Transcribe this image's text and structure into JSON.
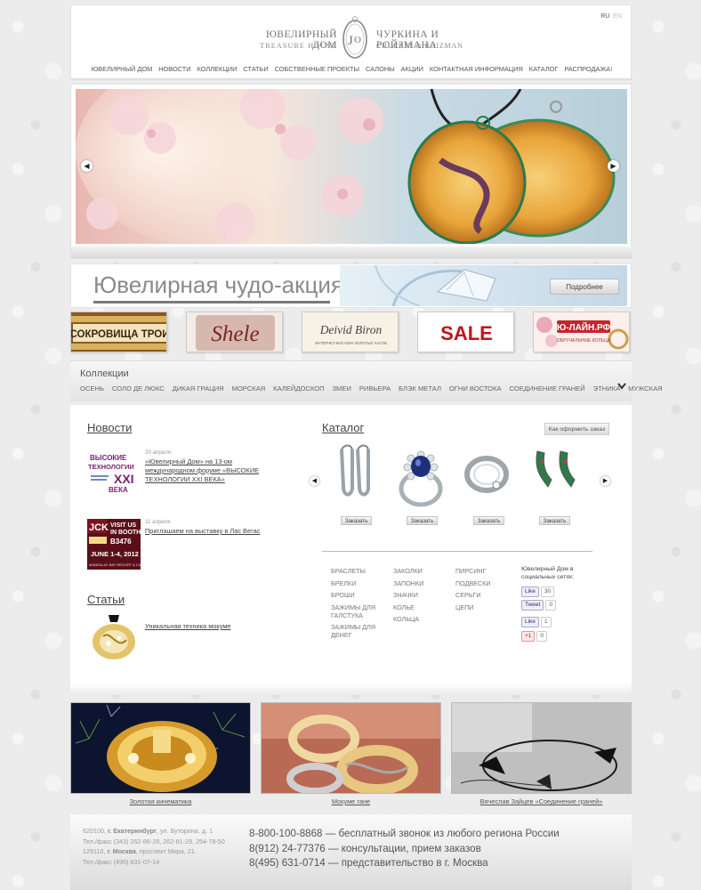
{
  "header": {
    "lang_active": "RU",
    "lang_other": "EN",
    "logo": {
      "left_line1": "ЮВЕЛИРНЫЙ ДОМ",
      "left_line2": "TREASURE HOUSE",
      "right_line1": "ЧУРКИНА И РОЙЗМАНА",
      "right_line2": "CHURKIN & ROIZMAN",
      "monogram": "ЮЭ"
    },
    "nav": [
      "ЮВЕЛИРНЫЙ ДОМ",
      "НОВОСТИ",
      "КОЛЛЕКЦИИ",
      "СТАТЬИ",
      "СОБСТВЕННЫЕ ПРОЕКТЫ",
      "САЛОНЫ",
      "АКЦИИ",
      "КОНТАКТНАЯ ИНФОРМАЦИЯ",
      "КАТАЛОГ",
      "РАСПРОДАЖА!"
    ]
  },
  "slider": {
    "prev_icon": "arrow-left-icon",
    "next_icon": "arrow-right-icon"
  },
  "promo": {
    "title": "Ювелирная чудо-акция!",
    "button": "Подробнее"
  },
  "brands": [
    "СОКРОВИЩА ТРОИ",
    "Shele",
    "Deivid Biron",
    "SALE",
    "Ю-ЛАЙН.РФ"
  ],
  "brand_sub": {
    "deivid": "ИНТЕРНЕТ-МАГАЗИН ЗОЛОТЫХ ЧАСОВ",
    "yuline": "ОБРУЧАЛЬНЫЕ КОЛЬЦА"
  },
  "collections": {
    "title": "Коллекции",
    "items": [
      "ОСЕНЬ",
      "СОЛО ДЕ ЛЮКС",
      "ДИКАЯ ГРАЦИЯ",
      "МОРСКАЯ",
      "КАЛЕЙДОСКОП",
      "ЗМЕИ",
      "РИВЬЕРА",
      "БЛЭК МЕТАЛ",
      "ОГНИ ВОСТОКА",
      "СОЕДИНЕНИЕ ГРАНЕЙ",
      "ЭТНИКА",
      "МУЖСКАЯ"
    ]
  },
  "news": {
    "title": "Новости",
    "items": [
      {
        "date": "20 апреля",
        "text": "«Ювелирный Дом» на 13-ом международном форуме «ВЫСОКИЕ ТЕХНОЛОГИИ XXI ВЕКА»",
        "thumb_text": "ВЫСОКИЕ ТЕХНОЛОГИИ XXI ВЕКА"
      },
      {
        "date": "11 апреля",
        "text": "Приглашаем на выставку в Лас Вегас",
        "thumb_text": "JCK VISIT US IN BOOTH B3476 JUNE 1-4, 2012"
      }
    ]
  },
  "articles": {
    "title": "Статьи",
    "items": [
      {
        "text": "Уникальная техника мокуме"
      }
    ]
  },
  "catalog": {
    "title": "Каталог",
    "order_howto": "Как оформить заказ",
    "order_button": "Заказать",
    "col1": [
      "БРАСЛЕТЫ",
      "БРЕЛКИ",
      "БРОШИ",
      "ЗАЖИМЫ ДЛЯ ГАЛСТУКА",
      "ЗАЖИМЫ ДЛЯ ДЕНЕГ"
    ],
    "col2": [
      "ЗАКОЛКИ",
      "ЗАПОНКИ",
      "ЗНАЧКИ",
      "КОЛЬЕ",
      "КОЛЬЦА"
    ],
    "col3": [
      "ПИРСИНГ",
      "ПОДВЕСКИ",
      "СЕРЬГИ",
      "ЦЕПИ"
    ]
  },
  "social": {
    "title": "Ювелирный Дом в социальных сетях:",
    "fb_label": "Like",
    "fb_count": "30",
    "tw_label": "Tweet",
    "tw_count": "0",
    "vk_label": "Like",
    "vk_count": "1",
    "gp_label": "+1",
    "gp_count": "0"
  },
  "features": [
    {
      "caption": "Золотая кинематика"
    },
    {
      "caption": "Мокуме гане"
    },
    {
      "caption": "Вячеслав Зайцев «Соединение граней»"
    }
  ],
  "footer": {
    "addr1_zip": "620100, ",
    "addr1_city": "г. Екатеринбург",
    "addr1_street": ", ул. Буторина, д. 1",
    "addr1_tel": "Тел./факс (343) 262-86-28, 262-81-29, 254-78-50",
    "addr2_zip": "129110, ",
    "addr2_city": "г. Москва",
    "addr2_street": ", проспект Мира, 21.",
    "addr2_tel": "Тел./факс (495) 631-07-14",
    "phones": [
      "8-800-100-8868 — бесплатный звонок из любого региона России",
      "8(912) 24-77376 — консультации, прием заказов",
      "8(495) 631-0714 — представительство в г. Москва"
    ]
  },
  "colors": {
    "accent_red": "#c0141a",
    "text": "#444444",
    "muted": "#999999"
  }
}
